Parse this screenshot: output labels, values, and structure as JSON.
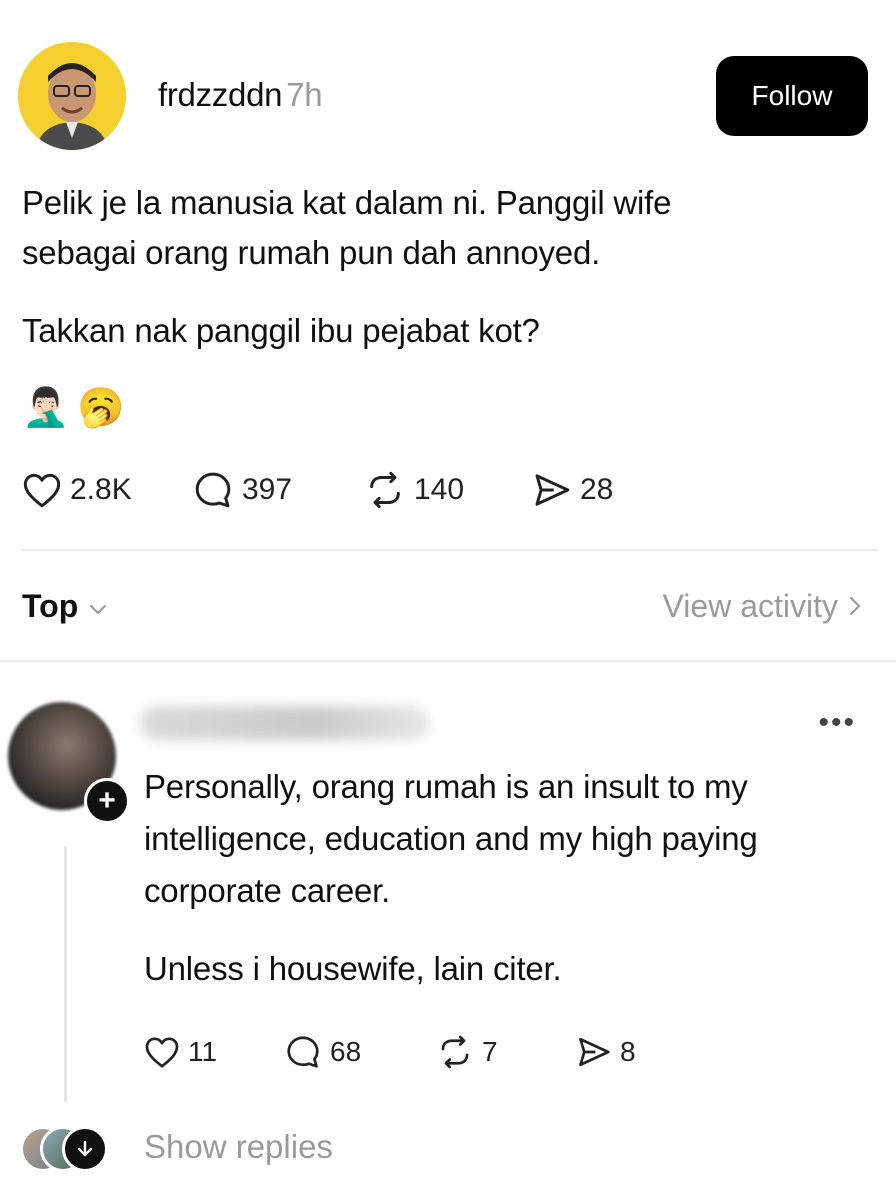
{
  "post": {
    "username": "frdzzddn",
    "time": "7h",
    "follow_label": "Follow",
    "paragraph1_line1": "Pelik je la manusia kat dalam ni. Panggil wife",
    "paragraph1_line2": "sebagai orang rumah pun dah annoyed.",
    "paragraph2": "Takkan nak panggil ibu pejabat kot?",
    "emoji1": "🤦🏻‍♂️",
    "emoji2": "🥱",
    "likes": "2.8K",
    "comments": "397",
    "reposts": "140",
    "shares": "28"
  },
  "sort": {
    "label": "Top",
    "view_activity": "View activity"
  },
  "reply": {
    "line1": "Personally, orang rumah is an insult to my",
    "line2": "intelligence, education and my high paying",
    "line3": "corporate career.",
    "line4": "Unless i housewife, lain citer.",
    "likes": "11",
    "comments": "68",
    "reposts": "7",
    "shares": "8",
    "more": "•••",
    "show_replies": "Show replies"
  }
}
